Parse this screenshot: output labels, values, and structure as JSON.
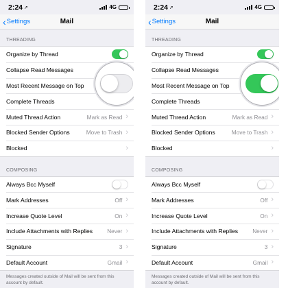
{
  "status": {
    "time": "2:24",
    "network": "4G"
  },
  "nav": {
    "back_label": "Settings",
    "title": "Mail"
  },
  "threading": {
    "header": "THREADING",
    "rows": {
      "organize": {
        "label": "Organize by Thread"
      },
      "collapse": {
        "label": "Collapse Read Messages"
      },
      "recent": {
        "label": "Most Recent Message on Top"
      },
      "complete": {
        "label": "Complete Threads"
      },
      "muted": {
        "label": "Muted Thread Action",
        "value": "Mark as Read"
      },
      "blocked_opts": {
        "label": "Blocked Sender Options",
        "value": "Move to Trash"
      },
      "blocked": {
        "label": "Blocked"
      }
    }
  },
  "composing": {
    "header": "COMPOSING",
    "rows": {
      "bcc": {
        "label": "Always Bcc Myself"
      },
      "mark": {
        "label": "Mark Addresses",
        "value": "Off"
      },
      "quote": {
        "label": "Increase Quote Level",
        "value": "On"
      },
      "attach": {
        "label": "Include Attachments with Replies",
        "value": "Never"
      },
      "signature": {
        "label": "Signature",
        "value": "3"
      },
      "default": {
        "label": "Default Account",
        "value": "Gmail"
      }
    },
    "footer": "Messages created outside of Mail will be sent from this account by default."
  },
  "states": {
    "left": {
      "organize_thread": "on",
      "most_recent_on_top": "off",
      "always_bcc": "off"
    },
    "right": {
      "organize_thread": "on",
      "most_recent_on_top": "on",
      "always_bcc": "off"
    }
  },
  "colors": {
    "accent": "#007aff",
    "toggle_on": "#34c759",
    "background": "#efeff4"
  },
  "icons": [
    "location-arrow-icon",
    "signal-icon",
    "battery-icon",
    "chevron-left-icon",
    "chevron-right-icon"
  ]
}
